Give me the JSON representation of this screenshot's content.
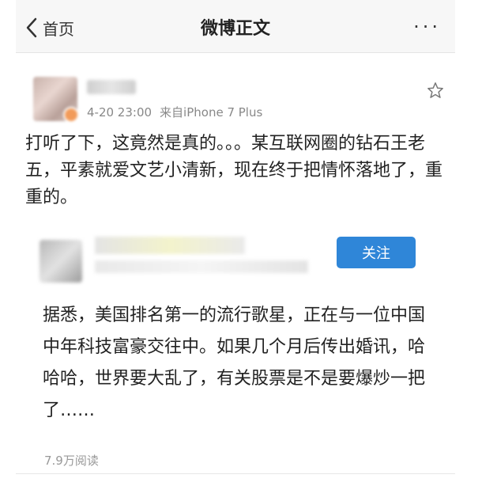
{
  "header": {
    "back_label": "首页",
    "title": "微博正文",
    "more_label": "···"
  },
  "post": {
    "date": "4-20 23:00",
    "source": "来自iPhone 7 Plus",
    "text": "打听了下，这竟然是真的。。。某互联网圈的钻石王老五，平素就爱文艺小清新，现在终于把情怀落地了，重重的。"
  },
  "repost": {
    "follow_label": "关注",
    "text": "据悉，美国排名第一的流行歌星，正在与一位中国中年科技富豪交往中。如果几个月后传出婚讯，哈哈哈，世界要大乱了，有关股票是不是要爆炒一把了……",
    "reads": "7.9万阅读"
  },
  "colors": {
    "accent": "#2f86d8",
    "meta_gray": "#888888"
  },
  "icons": {
    "back": "chevron-left-icon",
    "favorite": "star-outline-icon"
  }
}
